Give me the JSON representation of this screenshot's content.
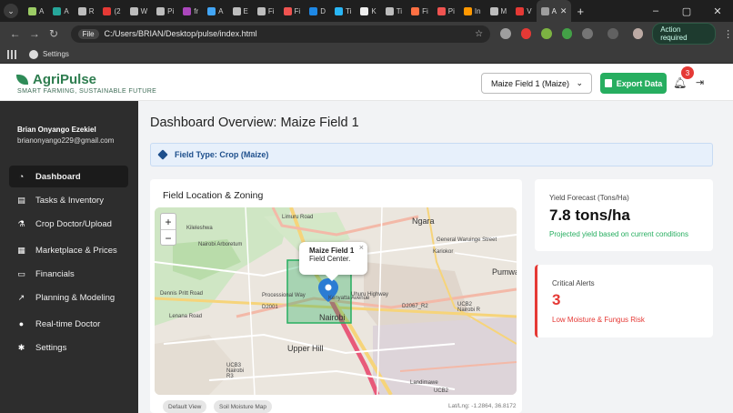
{
  "browser": {
    "tabs": [
      {
        "label": "A",
        "color": "#9ccc65"
      },
      {
        "label": "A",
        "color": "#26a69a"
      },
      {
        "label": "R",
        "color": "#bdbdbd"
      },
      {
        "label": "(2",
        "color": "#e53935"
      },
      {
        "label": "W",
        "color": "#bdbdbd"
      },
      {
        "label": "Pi",
        "color": "#bdbdbd"
      },
      {
        "label": "fr",
        "color": "#ab47bc"
      },
      {
        "label": "A",
        "color": "#42a5f5"
      },
      {
        "label": "E",
        "color": "#bdbdbd"
      },
      {
        "label": "Fi",
        "color": "#bdbdbd"
      },
      {
        "label": "Fi",
        "color": "#ef5350"
      },
      {
        "label": "D",
        "color": "#1e88e5"
      },
      {
        "label": "Ti",
        "color": "#29b6f6"
      },
      {
        "label": "K",
        "color": "#eeeeee"
      },
      {
        "label": "Ti",
        "color": "#bdbdbd"
      },
      {
        "label": "Fi",
        "color": "#ff7043"
      },
      {
        "label": "Pi",
        "color": "#ef5350"
      },
      {
        "label": "In",
        "color": "#ff9800"
      },
      {
        "label": "M",
        "color": "#bdbdbd"
      },
      {
        "label": "V",
        "color": "#e53935"
      }
    ],
    "active_tab": {
      "label": "A",
      "color": "#9e9e9e"
    },
    "new_tab": "+",
    "window_controls": {
      "minimize": "–",
      "maximize": "▢",
      "close": "✕"
    },
    "url_chip": "File",
    "url": "C:/Users/BRIAN/Desktop/pulse/index.html",
    "action_required": "Action required",
    "bookmarks": [
      {
        "label": "Settings"
      }
    ]
  },
  "header": {
    "app_name": "AgriPulse",
    "tagline": "SMART FARMING, SUSTAINABLE FUTURE",
    "field_select": "Maize Field 1 (Maize)",
    "export_label": "Export Data",
    "notification_count": "3"
  },
  "sidebar": {
    "user_name": "Brian Onyango Ezekiel",
    "user_email": "brianonyango229@gmail.com",
    "items": [
      {
        "label": "Dashboard",
        "icon": "dashboard-icon",
        "glyph": "◔",
        "active": true
      },
      {
        "label": "Tasks & Inventory",
        "icon": "tasks-icon",
        "glyph": "▤",
        "active": false
      },
      {
        "label": "Crop Doctor/Upload",
        "icon": "crop-doctor-icon",
        "glyph": "⚗",
        "active": false
      },
      {
        "label": "Marketplace & Prices",
        "icon": "store-icon",
        "glyph": "▦",
        "active": false
      },
      {
        "label": "Financials",
        "icon": "financials-icon",
        "glyph": "▭",
        "active": false
      },
      {
        "label": "Planning & Modeling",
        "icon": "chart-icon",
        "glyph": "↗",
        "active": false
      },
      {
        "label": "Real-time Doctor",
        "icon": "doctor-icon",
        "glyph": "●",
        "active": false
      },
      {
        "label": "Settings",
        "icon": "gear-icon",
        "glyph": "✱",
        "active": false
      }
    ]
  },
  "main": {
    "title": "Dashboard Overview: Maize Field 1",
    "field_type": "Field Type: Crop (Maize)",
    "map": {
      "title": "Field Location & Zoning",
      "zoom_in": "+",
      "zoom_out": "−",
      "popup_title": "Maize Field 1",
      "popup_text": "Field Center.",
      "popup_close": "×",
      "labels": {
        "nairobi": "Nairobi",
        "ngara": "Ngara",
        "upper_hill": "Upper Hill",
        "landimawe": "Landimawe",
        "kariokor": "Kariokor",
        "pumwani": "Pumwa",
        "kileleshwa": "Kileleshwa",
        "nairobi_arboretum": "Nairobi Arboretum",
        "d2001": "D2001",
        "d2067": "D2067_R2",
        "ucb2_a": "UCB2 Nairobi R",
        "ucb3": "UCB3 Nairobi R3",
        "ucb2_b": "UCB2",
        "kenyatta": "Kenyatta Avenue",
        "dennis_pritt": "Dennis Pritt Road",
        "lenana": "Lenana Road",
        "processional": "Processional Way",
        "uhuru": "Uhuru Highway",
        "limuru": "Limuru Road",
        "general_waruinge": "General Waruinge Street"
      },
      "tabs": [
        {
          "label": "Default View"
        },
        {
          "label": "Soil Moisture Map"
        }
      ],
      "latlng": "Lat/Lng: -1.2864, 36.8172"
    },
    "yield": {
      "label": "Yield Forecast (Tons/Ha)",
      "value": "7.8 tons/ha",
      "sub": "Projected yield based on current conditions"
    },
    "alerts": {
      "label": "Critical Alerts",
      "value": "3",
      "sub": "Low Moisture & Fungus Risk"
    }
  }
}
